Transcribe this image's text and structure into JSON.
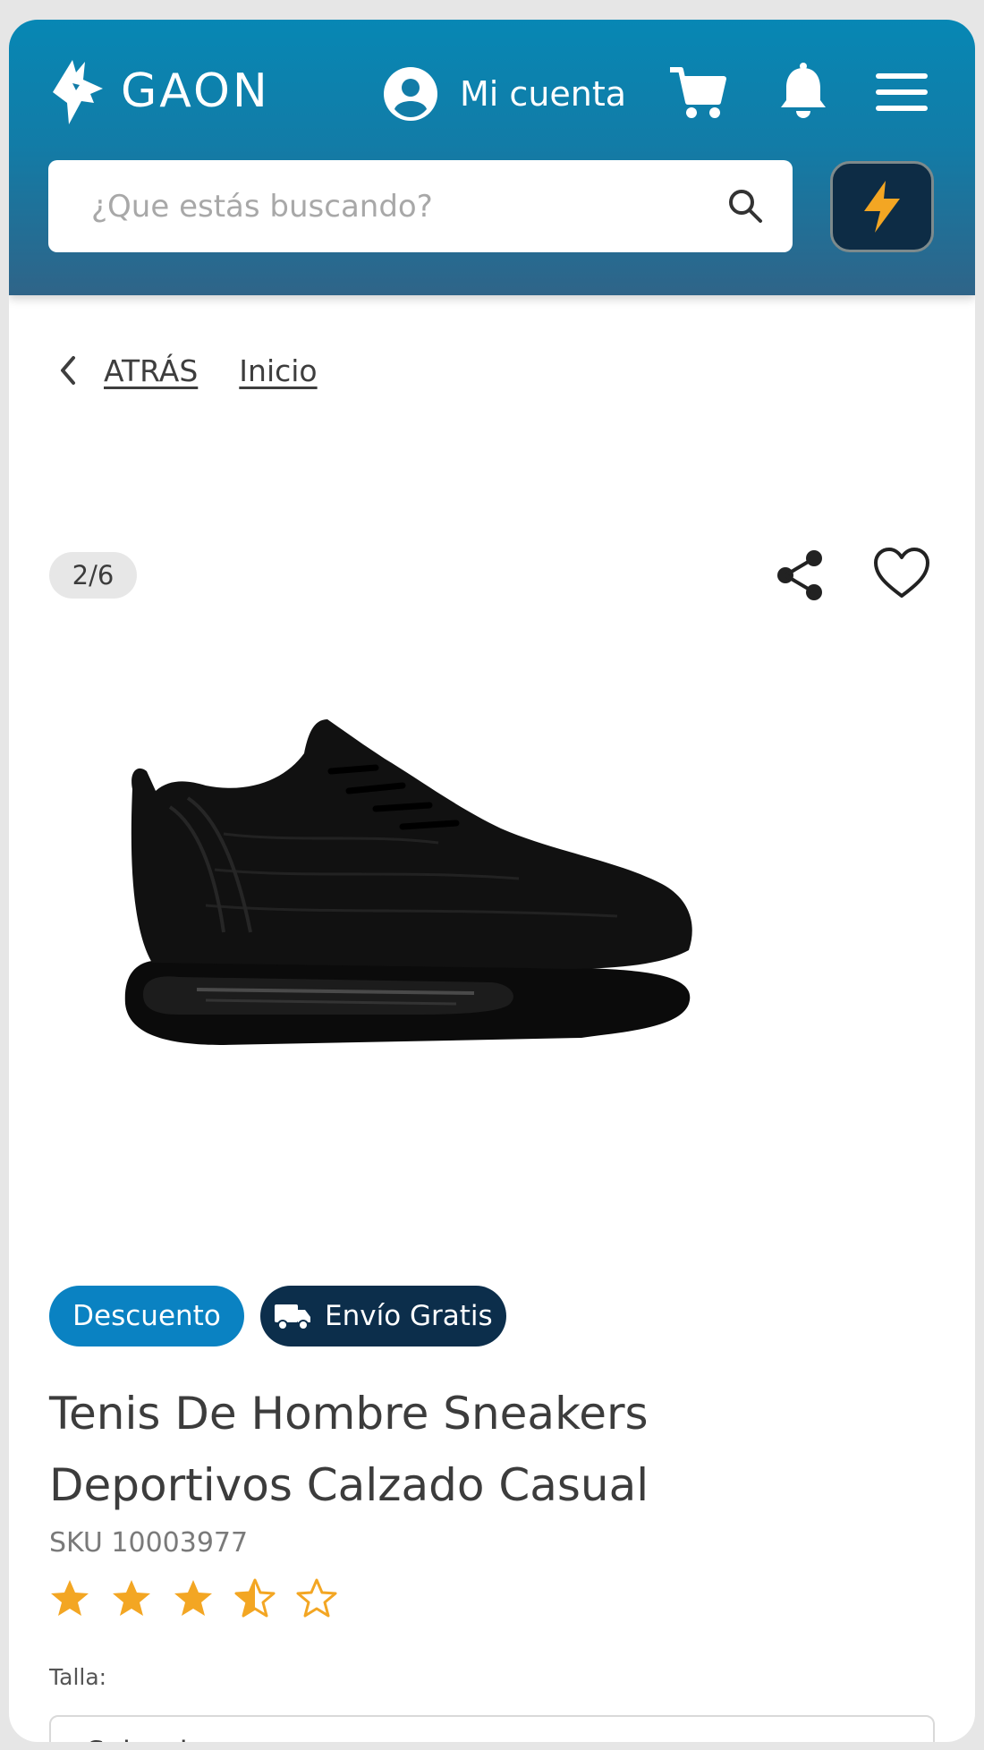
{
  "header": {
    "logo_text": "GAON",
    "account_label": "Mi cuenta",
    "search_placeholder": "¿Que estás buscando?",
    "colors": {
      "gradient_top": "#0787b4",
      "gradient_bottom": "#2f6488",
      "flash_bg": "#0d2c45",
      "flash_bolt": "#f3a623"
    }
  },
  "breadcrumb": {
    "back_label": "ATRÁS",
    "home_label": "Inicio"
  },
  "gallery": {
    "counter": "2/6",
    "current_index": 2,
    "total_images": 6,
    "image_alt": "black-sneaker"
  },
  "product": {
    "badges": [
      {
        "label": "Descuento",
        "color": "#0a82c2"
      },
      {
        "label": "Envío Gratis",
        "color": "#0c2e4b",
        "icon": "truck-icon"
      }
    ],
    "title": "Tenis De Hombre Sneakers Deportivos Calzado Casual",
    "sku": "SKU 10003977",
    "rating": 3.5,
    "rating_max": 5,
    "star_color": "#f3a623",
    "size_label": "Talla:",
    "size_select_value": "Seleccionar"
  }
}
